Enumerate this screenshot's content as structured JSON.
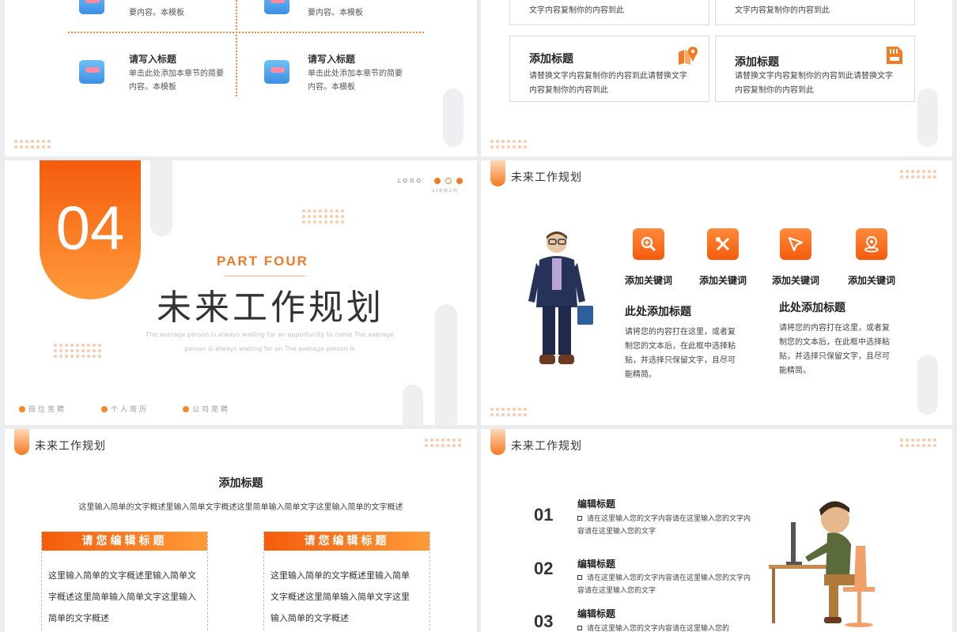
{
  "slide1": {
    "items": [
      {
        "title": "",
        "desc_tail": "要内容。本模板"
      },
      {
        "title": "",
        "desc_tail": "要内容。本模板"
      },
      {
        "title": "请写入标题",
        "desc": "单击此处添加本章节的简要内容。本模板"
      },
      {
        "title": "请写入标题",
        "desc": "单击此处添加本章节的简要内容。本模板"
      }
    ]
  },
  "slide2": {
    "top_boxes": [
      {
        "desc": "文字内容复制你的内容到此"
      },
      {
        "desc": "文字内容复制你的内容到此"
      }
    ],
    "boxes": [
      {
        "title": "添加标题",
        "desc": "请替换文字内容复制你的内容到此请替换文字内容复制你的内容到此",
        "icon": "map-pin-icon"
      },
      {
        "title": "添加标题",
        "desc": "请替换文字内容复制你的内容到此请替换文字内容复制你的内容到此",
        "icon": "sd-card-icon"
      }
    ]
  },
  "slide3": {
    "number": "04",
    "part": "PART FOUR",
    "title": "未来工作规划",
    "subtitle": "The average person is always waiting for an opportunity to come The average person is always waiting for an The average person is",
    "logo": "LOGO",
    "logo_sub": "XX有限公司",
    "footer": [
      "岗位竞聘",
      "个人简历",
      "公司竞聘"
    ]
  },
  "slide4": {
    "header": "未来工作规划",
    "keywords": [
      {
        "label": "添加关键词",
        "icon": "search-icon"
      },
      {
        "label": "添加关键词",
        "icon": "tools-icon"
      },
      {
        "label": "添加关键词",
        "icon": "cursor-icon"
      },
      {
        "label": "添加关键词",
        "icon": "location-icon"
      }
    ],
    "blocks": [
      {
        "title": "此处添加标题",
        "body": "请将您的内容打在这里，或者复制您的文本后，在此框中选择粘贴，并选择只保留文字，且尽可能精简。"
      },
      {
        "title": "此处添加标题",
        "body": "请将您的内容打在这里，或者复制您的文本后，在此框中选择粘贴，并选择只保留文字，且尽可能精简。"
      }
    ]
  },
  "slide5": {
    "header": "未来工作规划",
    "title": "添加标题",
    "subtitle": "这里输入简单的文字概述里输入简单文字概述这里简单输入简单文字这里输入简单的文字概述",
    "cards": [
      {
        "title": "请您编辑标题",
        "text": "这里输入简单的文字概述里输入简单文字概述这里简单输入简单文字这里输入简单的文字概述"
      },
      {
        "title": "请您编辑标题",
        "text": "这里输入简单的文字概述里输入简单文字概述这里简单输入简单文字这里输入简单的文字概述"
      }
    ]
  },
  "slide6": {
    "header": "未来工作规划",
    "items": [
      {
        "num": "01",
        "title": "编辑标题",
        "desc": "请在这里输入您的文字内容请在这里输入您的文字内容请在这里输入您的文字"
      },
      {
        "num": "02",
        "title": "编辑标题",
        "desc": "请在这里输入您的文字内容请在这里输入您的文字内容请在这里输入您的文字"
      },
      {
        "num": "03",
        "title": "编辑标题",
        "desc": "请在这里输入您的文字内容请在这里输入您的"
      }
    ]
  },
  "colors": {
    "accent": "#f47a20",
    "accent_dark": "#f45c0c",
    "accent_light": "#ff9b3a"
  }
}
